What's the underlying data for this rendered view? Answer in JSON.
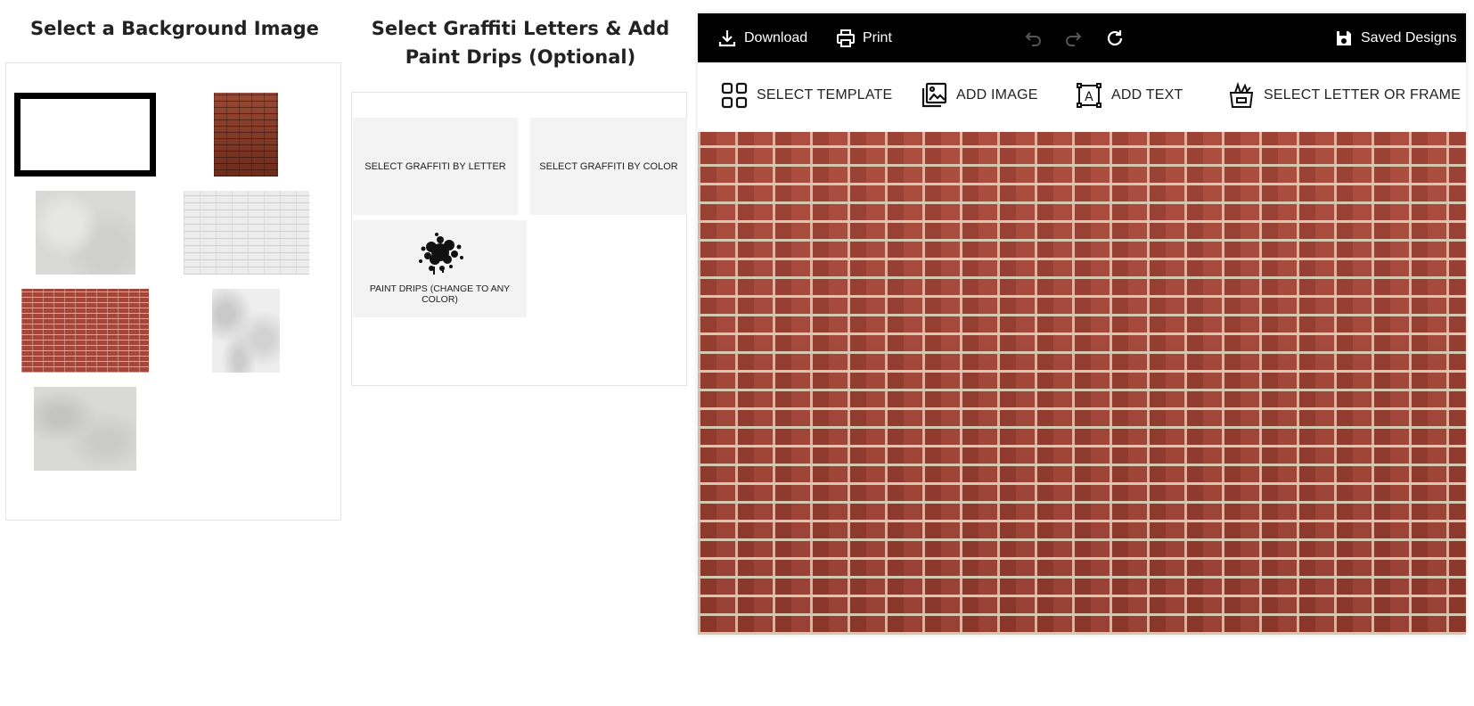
{
  "background_section": {
    "title": "Select a Background Image",
    "thumbnails": [
      {
        "name": "blank-white"
      },
      {
        "name": "dark-brick"
      },
      {
        "name": "gray-stucco"
      },
      {
        "name": "whitewashed-brick"
      },
      {
        "name": "red-brick"
      },
      {
        "name": "white-marble"
      },
      {
        "name": "gray-marble"
      }
    ]
  },
  "graffiti_section": {
    "title": "Select Graffiti Letters & Add Paint Drips (Optional)",
    "cards": [
      {
        "label": "SELECT GRAFFITI BY LETTER"
      },
      {
        "label": "SELECT GRAFFITI BY COLOR"
      },
      {
        "label": "PAINT DRIPS (CHANGE TO ANY COLOR)"
      }
    ]
  },
  "editor": {
    "topbar": {
      "download_label": "Download",
      "print_label": "Print",
      "saved_designs_label": "Saved Designs"
    },
    "toolbar": {
      "select_template_label": "SELECT TEMPLATE",
      "add_image_label": "ADD IMAGE",
      "add_text_label": "ADD TEXT",
      "select_letter_label": "SELECT LETTER OR FRAME"
    },
    "canvas_background": "red-brick"
  }
}
